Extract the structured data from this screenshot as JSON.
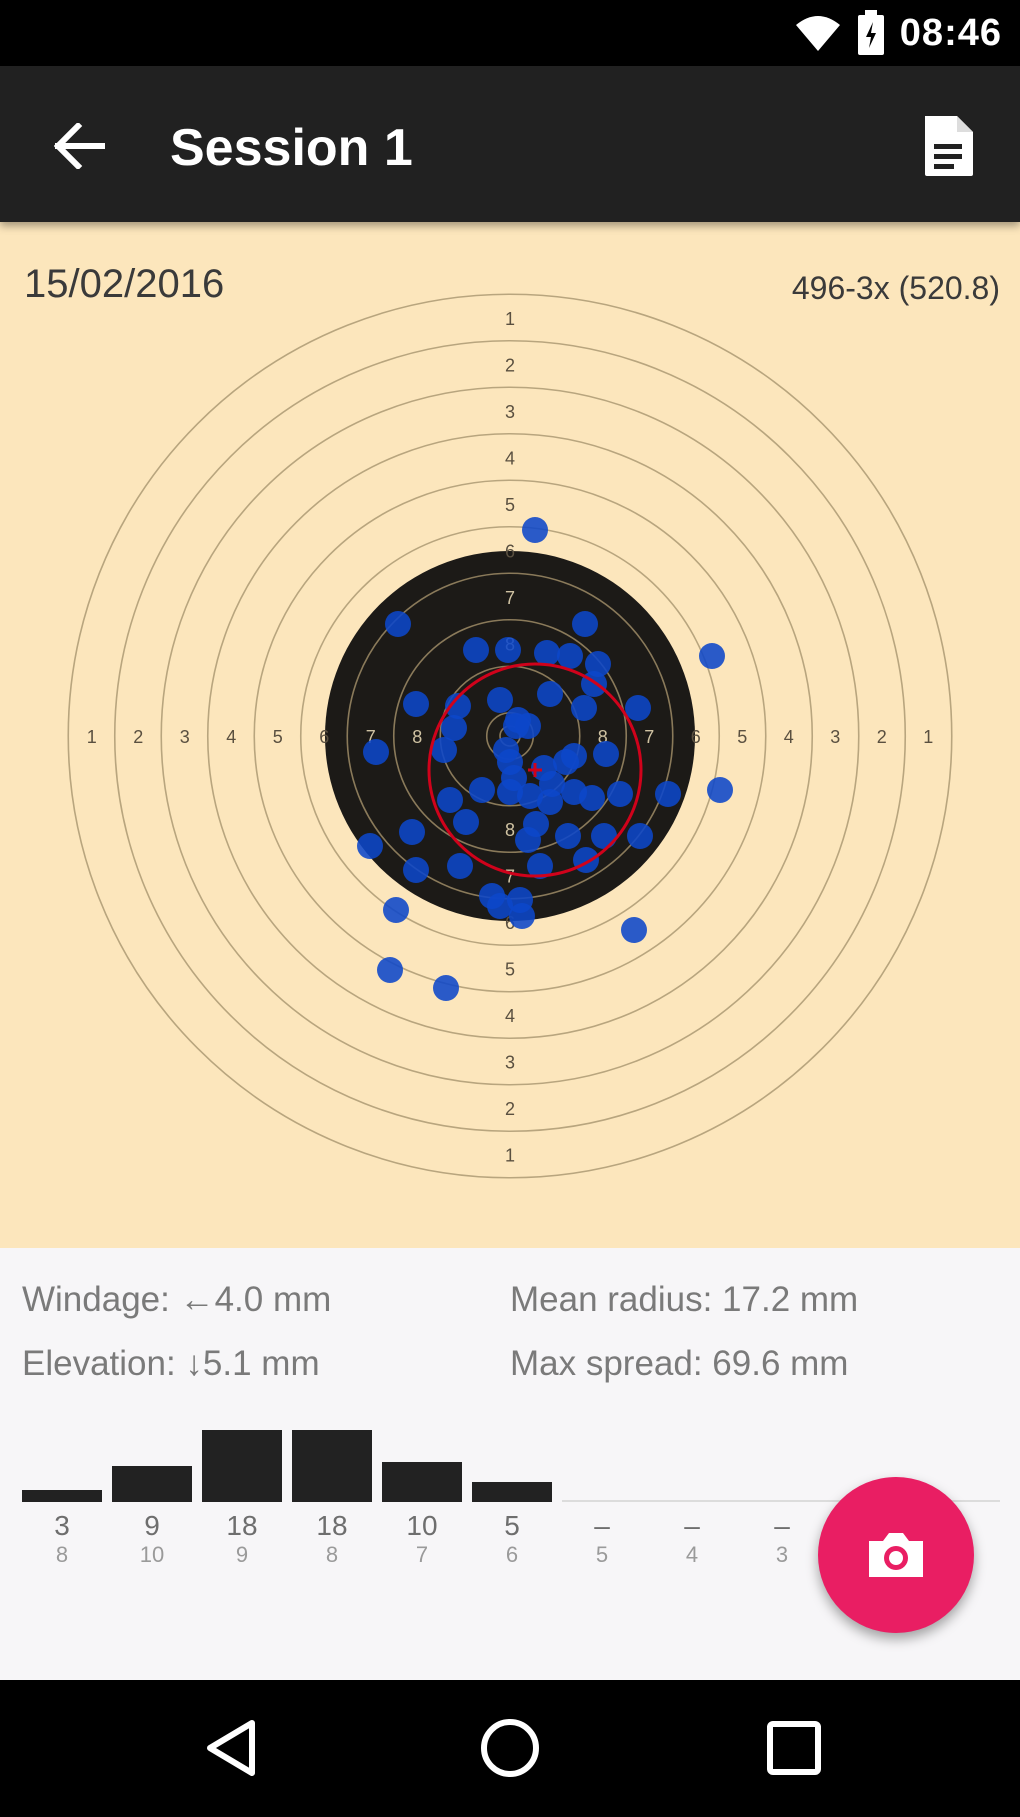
{
  "status_bar": {
    "time": "08:46",
    "icons": [
      "wifi-icon",
      "battery-icon"
    ]
  },
  "app_bar": {
    "title": "Session 1",
    "back_icon": "arrow-back-icon",
    "action_icon": "document-icon"
  },
  "target": {
    "date": "15/02/2016",
    "score": "496-3x (520.8)",
    "ring_numbers": [
      "1",
      "2",
      "3",
      "4",
      "5",
      "6",
      "7",
      "8"
    ],
    "colors": {
      "paper": "#fce6bc",
      "black": "#1c1a17",
      "ring": "#b8a57e",
      "shot": "#0d47c9",
      "group": "#d0021b"
    }
  },
  "stats": {
    "windage": "Windage: ←4.0 mm",
    "elevation": "Elevation: ↓5.1 mm",
    "mean_radius": "Mean radius: 17.2 mm",
    "max_spread": "Max spread: 69.6 mm"
  },
  "histogram": [
    {
      "score": "8",
      "count": "3",
      "value": 3
    },
    {
      "score": "10",
      "count": "9",
      "value": 9
    },
    {
      "score": "9",
      "count": "18",
      "value": 18
    },
    {
      "score": "8",
      "count": "18",
      "value": 18
    },
    {
      "score": "7",
      "count": "10",
      "value": 10
    },
    {
      "score": "6",
      "count": "5",
      "value": 5
    },
    {
      "score": "5",
      "count": "–",
      "value": 0
    },
    {
      "score": "4",
      "count": "–",
      "value": 0
    },
    {
      "score": "3",
      "count": "–",
      "value": 0
    }
  ],
  "fab": {
    "icon": "camera-icon",
    "color": "#e91e63"
  },
  "nav_bar": {
    "icons": [
      "back-triangle-icon",
      "home-circle-icon",
      "recents-square-icon"
    ]
  }
}
